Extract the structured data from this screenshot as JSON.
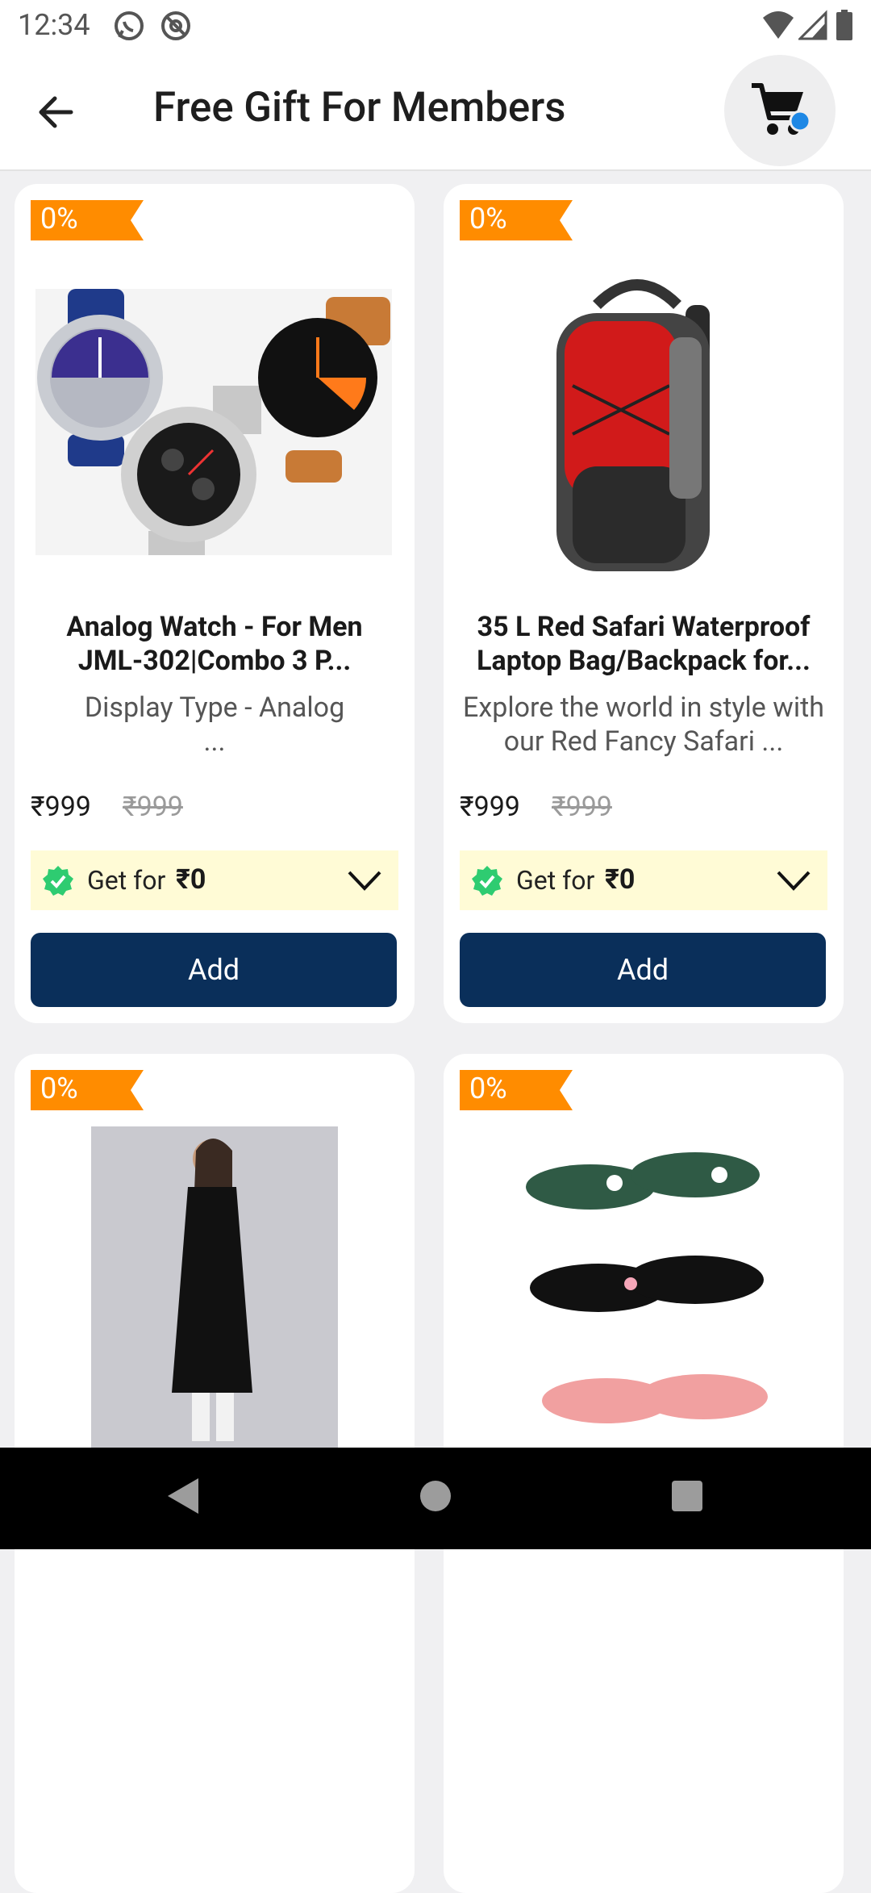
{
  "status_bar": {
    "time": "12:34"
  },
  "header": {
    "title": "Free Gift For Members"
  },
  "colors": {
    "tag": "#ff8c00",
    "add_button": "#0a2f5a",
    "get_for_bg": "#fffbd6",
    "check": "#2ecc71",
    "cart_dot": "#1e88e5"
  },
  "products": [
    {
      "discount": "0%",
      "title": "Analog Watch - For Men JML-302|Combo 3 P...",
      "description": "Display Type - Analog",
      "description_more": "...",
      "price": "₹999",
      "mrp": "₹999",
      "get_for_label": "Get for",
      "get_for_price": "₹0",
      "add_label": "Add",
      "image": "watch-combo"
    },
    {
      "discount": "0%",
      "title": "35 L Red Safari Waterproof Laptop Bag/Backpack for...",
      "description": "Explore the world in style with our Red Fancy Safari ...",
      "price": "₹999",
      "mrp": "₹999",
      "get_for_label": "Get for",
      "get_for_price": "₹0",
      "add_label": "Add",
      "image": "red-backpack"
    },
    {
      "discount": "0%",
      "image": "black-kurta"
    },
    {
      "discount": "0%",
      "image": "flip-flops"
    }
  ]
}
